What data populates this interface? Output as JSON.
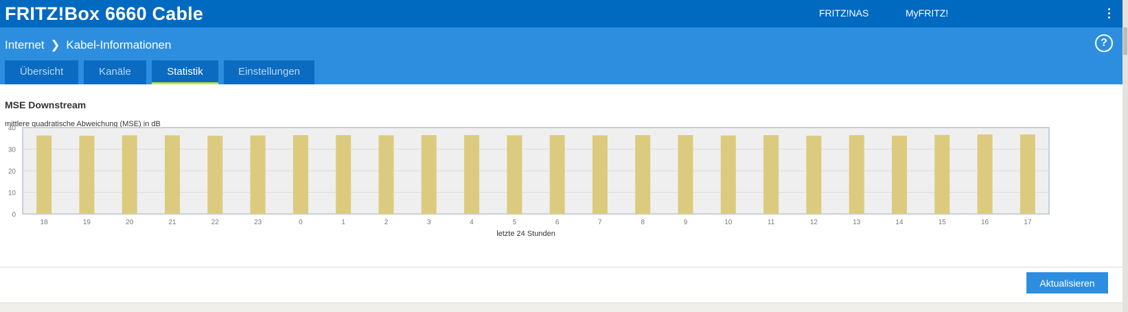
{
  "header": {
    "brand": "FRITZ!Box 6660 Cable",
    "links": [
      "FRITZ!NAS",
      "MyFRITZ!"
    ]
  },
  "breadcrumb": {
    "parent": "Internet",
    "current": "Kabel-Informationen"
  },
  "tabs": [
    {
      "label": "Übersicht",
      "active": false
    },
    {
      "label": "Kanäle",
      "active": false
    },
    {
      "label": "Statistik",
      "active": true
    },
    {
      "label": "Einstellungen",
      "active": false
    }
  ],
  "section": {
    "title": "MSE Downstream",
    "subtitle": "mittlere quadratische Abweichung (MSE) in dB"
  },
  "chart_data": {
    "type": "bar",
    "title": "MSE Downstream",
    "ylabel": "mittlere quadratische Abweichung (MSE) in dB",
    "xlabel": "letzte 24 Stunden",
    "ylim": [
      0,
      40
    ],
    "yticks": [
      0,
      10,
      20,
      30,
      40
    ],
    "grid": true,
    "categories": [
      "18",
      "19",
      "20",
      "21",
      "22",
      "23",
      "0",
      "1",
      "2",
      "3",
      "4",
      "5",
      "6",
      "7",
      "8",
      "9",
      "10",
      "11",
      "12",
      "13",
      "14",
      "15",
      "16",
      "17"
    ],
    "values": [
      36.3,
      36.2,
      36.4,
      36.4,
      36.2,
      36.3,
      36.5,
      36.5,
      36.4,
      36.5,
      36.5,
      36.4,
      36.5,
      36.4,
      36.5,
      36.5,
      36.3,
      36.5,
      36.2,
      36.5,
      36.2,
      36.6,
      36.8,
      36.8
    ],
    "bar_color": "#dccb7e"
  },
  "actions": {
    "refresh_label": "Aktualisieren"
  },
  "colors": {
    "header_bg": "#0069c0",
    "subheader_bg": "#2d8ee0",
    "tab_bg": "#0a6bc1",
    "tab_active_underline": "#c6e13e",
    "button_bg": "#2d8ee0"
  }
}
